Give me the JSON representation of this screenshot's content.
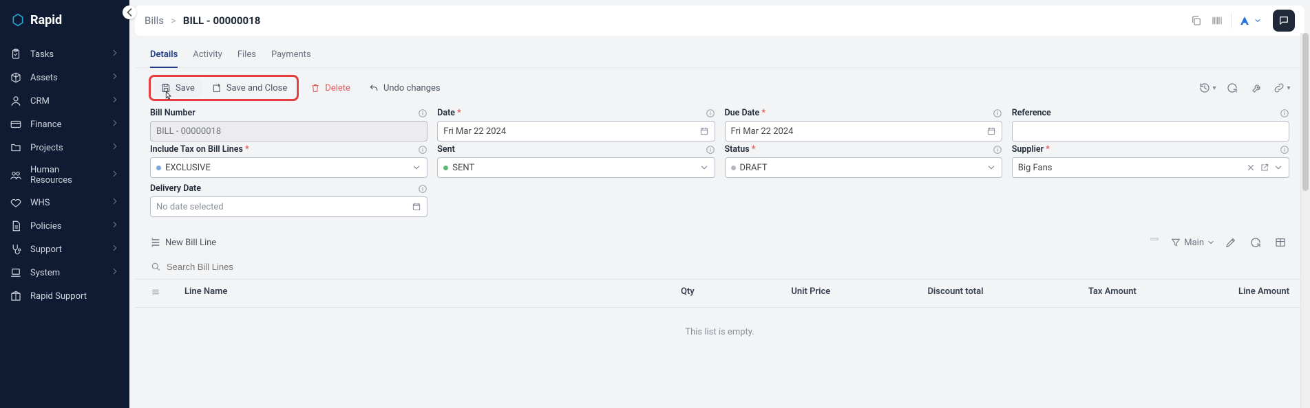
{
  "brand": "Rapid",
  "sidebar": {
    "items": [
      {
        "label": "Tasks",
        "icon": "clipboard",
        "chev": true
      },
      {
        "label": "Assets",
        "icon": "cube",
        "chev": true
      },
      {
        "label": "CRM",
        "icon": "user",
        "chev": true
      },
      {
        "label": "Finance",
        "icon": "card",
        "chev": true
      },
      {
        "label": "Projects",
        "icon": "folder",
        "chev": true
      },
      {
        "label": "Human Resources",
        "icon": "people",
        "chev": true
      },
      {
        "label": "WHS",
        "icon": "heart",
        "chev": true
      },
      {
        "label": "Policies",
        "icon": "doc",
        "chev": true
      },
      {
        "label": "Support",
        "icon": "stetho",
        "chev": true
      },
      {
        "label": "System",
        "icon": "laptop",
        "chev": true
      },
      {
        "label": "Rapid Support",
        "icon": "box",
        "chev": false
      }
    ]
  },
  "breadcrumb": {
    "root": "Bills",
    "sep": ">",
    "current": "BILL - 00000018"
  },
  "tabs": [
    "Details",
    "Activity",
    "Files",
    "Payments"
  ],
  "active_tab": 0,
  "toolbar": {
    "save": "Save",
    "save_close": "Save and Close",
    "delete": "Delete",
    "undo": "Undo changes"
  },
  "fields": {
    "bill_number": {
      "label": "Bill Number",
      "value": "BILL - 00000018"
    },
    "date": {
      "label": "Date",
      "required": true,
      "value": "Fri Mar 22 2024"
    },
    "due_date": {
      "label": "Due Date",
      "required": true,
      "value": "Fri Mar 22 2024"
    },
    "reference": {
      "label": "Reference",
      "value": ""
    },
    "include_tax": {
      "label": "Include Tax on Bill Lines",
      "required": true,
      "value": "EXCLUSIVE"
    },
    "sent": {
      "label": "Sent",
      "value": "SENT"
    },
    "status": {
      "label": "Status",
      "required": true,
      "value": "DRAFT"
    },
    "supplier": {
      "label": "Supplier",
      "required": true,
      "value": "Big Fans"
    },
    "delivery": {
      "label": "Delivery Date",
      "placeholder": "No date selected"
    }
  },
  "list": {
    "new": "New Bill Line",
    "search_placeholder": "Search Bill Lines",
    "filter_label": "Main",
    "columns": {
      "line_name": "Line Name",
      "qty": "Qty",
      "unit_price": "Unit Price",
      "discount": "Discount total",
      "tax": "Tax Amount",
      "amount": "Line Amount"
    },
    "empty": "This list is empty."
  }
}
